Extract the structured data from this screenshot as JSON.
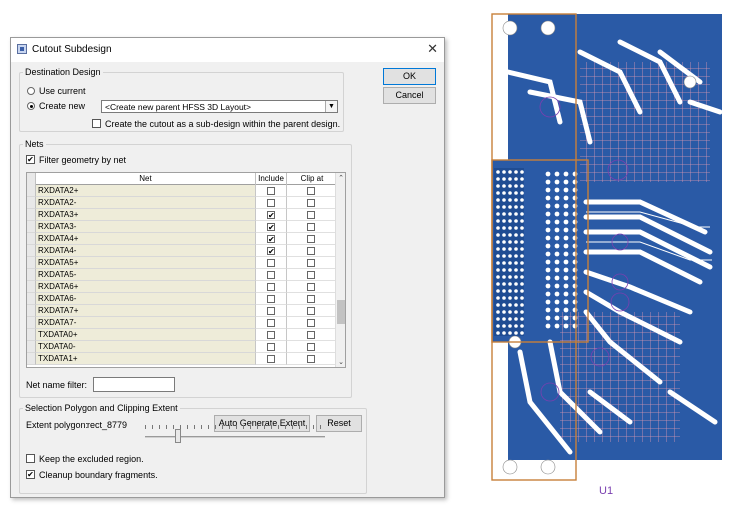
{
  "dialog": {
    "title": "Cutout Subdesign",
    "ok_label": "OK",
    "cancel_label": "Cancel"
  },
  "destination": {
    "legend": "Destination Design",
    "use_current_label": "Use current",
    "create_new_label": "Create new",
    "selected_option": "create_new",
    "dropdown_value": "<Create new parent HFSS 3D Layout>",
    "subdesign_label": "Create the cutout as a sub-design within the parent design.",
    "subdesign_checked": false
  },
  "nets": {
    "legend": "Nets",
    "filter_label": "Filter geometry by net",
    "filter_checked": true,
    "headers": {
      "net": "Net",
      "include": "Include",
      "clip": "Clip at extents"
    },
    "rows": [
      {
        "net": "RXDATA2+",
        "include": false,
        "clip": false
      },
      {
        "net": "RXDATA2-",
        "include": false,
        "clip": false
      },
      {
        "net": "RXDATA3+",
        "include": true,
        "clip": false
      },
      {
        "net": "RXDATA3-",
        "include": true,
        "clip": false
      },
      {
        "net": "RXDATA4+",
        "include": true,
        "clip": false
      },
      {
        "net": "RXDATA4-",
        "include": true,
        "clip": false
      },
      {
        "net": "RXDATA5+",
        "include": false,
        "clip": false
      },
      {
        "net": "RXDATA5-",
        "include": false,
        "clip": false
      },
      {
        "net": "RXDATA6+",
        "include": false,
        "clip": false
      },
      {
        "net": "RXDATA6-",
        "include": false,
        "clip": false
      },
      {
        "net": "RXDATA7+",
        "include": false,
        "clip": false
      },
      {
        "net": "RXDATA7-",
        "include": false,
        "clip": false
      },
      {
        "net": "TXDATA0+",
        "include": false,
        "clip": false
      },
      {
        "net": "TXDATA0-",
        "include": false,
        "clip": false
      },
      {
        "net": "TXDATA1+",
        "include": false,
        "clip": false
      }
    ],
    "filter_input_label": "Net name filter:",
    "filter_input_value": ""
  },
  "selection": {
    "legend": "Selection Polygon and Clipping Extent",
    "extent_label": "Extent polygon:",
    "extent_value": "rect_8779",
    "auto_generate_label": "Auto Generate Extent",
    "reset_label": "Reset",
    "keep_excluded_label": "Keep the excluded region.",
    "keep_excluded_checked": false,
    "cleanup_label": "Cleanup boundary fragments.",
    "cleanup_checked": true,
    "slider_level": 0.17
  },
  "pcb": {
    "component_label": "U1",
    "colors": {
      "board": "#2a5aa6",
      "outline": "#c8803a",
      "keepout": "#f2a0b4",
      "outline_label": "#7a3fb0"
    }
  }
}
